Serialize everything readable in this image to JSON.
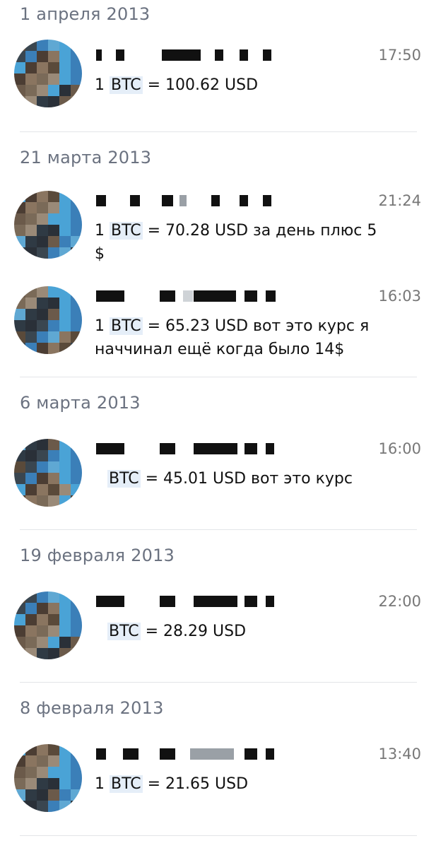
{
  "dates": [
    "1 апреля 2013",
    "21 марта 2013",
    "6 марта 2013",
    "19 февраля 2013",
    "8 февраля 2013"
  ],
  "messages": [
    {
      "time": "17:50",
      "prefix": "1 ",
      "btc": "BTC",
      "rest": " =  100.62 USD",
      "line2": ""
    },
    {
      "time": "21:24",
      "prefix": "1 ",
      "btc": "BTC",
      "rest": " = 70.28 USD за день плюс 5 $",
      "line2": ""
    },
    {
      "time": "16:03",
      "prefix": "1 ",
      "btc": "BTC",
      "rest": " = 65.23 USD вот это курс я",
      "line2": "наччинал ещё когда было 14$"
    },
    {
      "time": "16:00",
      "prefix": "",
      "btc": "BTC",
      "rest": " = 45.01 USD вот это курс",
      "line2": ""
    },
    {
      "time": "22:00",
      "prefix": "",
      "btc": "BTC",
      "rest": " =  28.29 USD",
      "line2": ""
    },
    {
      "time": "13:40",
      "prefix": "1 ",
      "btc": "BTC",
      "rest": " = 21.65 USD",
      "line2": ""
    }
  ],
  "colors": {
    "date": "#6b7280",
    "time": "#777777",
    "btc_highlight": "#e5eef8",
    "divider": "#e3e5e8"
  },
  "icons": {
    "avatar": "pixelated-avatar"
  }
}
